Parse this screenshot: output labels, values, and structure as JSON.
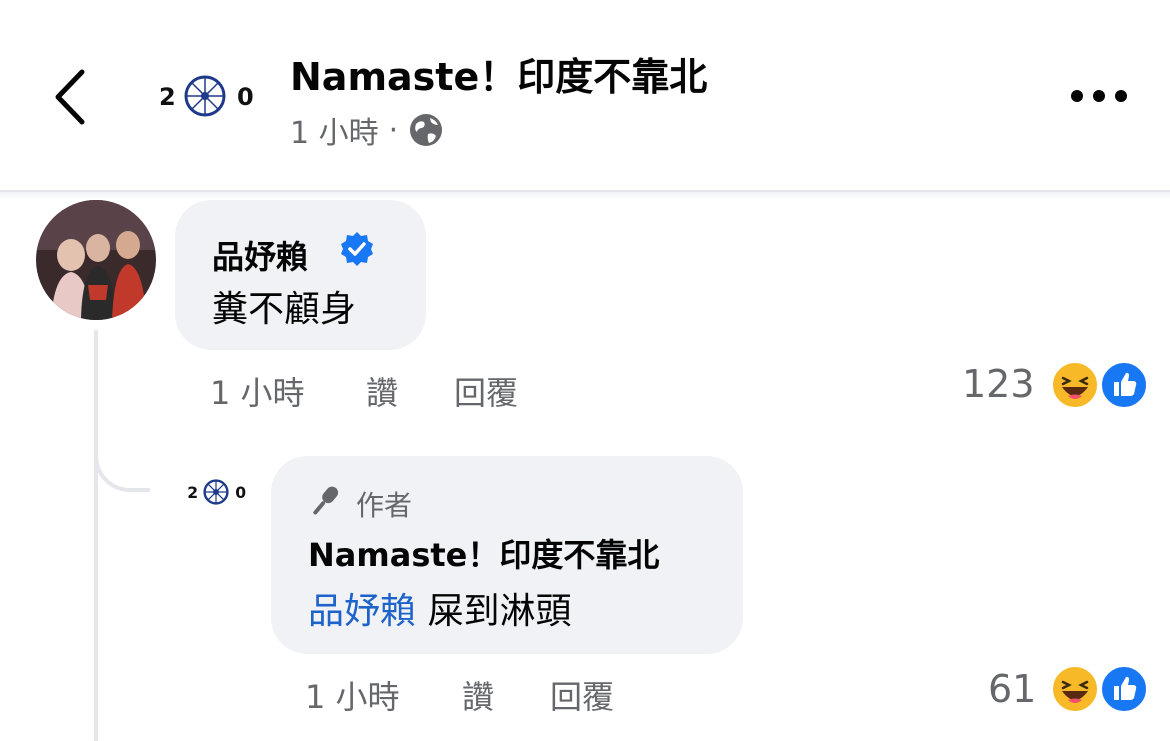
{
  "header": {
    "title": "Namaste！印度不靠北",
    "time": "1 小時",
    "separator": "·",
    "avatar_text_left": "2",
    "avatar_text_right": "0"
  },
  "comments": [
    {
      "author": "品妤賴",
      "verified": true,
      "text": "糞不顧身",
      "time": "1 小時",
      "like_label": "讚",
      "reply_label": "回覆",
      "reaction_count": "123",
      "reactions": [
        "haha-icon",
        "like-icon"
      ]
    },
    {
      "author_badge": "作者",
      "author": "Namaste！印度不靠北",
      "mention": "品妤賴",
      "text": "屎到淋頭",
      "time": "1 小時",
      "like_label": "讚",
      "reply_label": "回覆",
      "reaction_count": "61",
      "reactions": [
        "haha-icon",
        "like-icon"
      ]
    }
  ],
  "colors": {
    "saffron": "#f39a1c",
    "green": "#2f9a3a",
    "chakra": "#1f3a8a",
    "mention": "#1d63c9",
    "verified": "#1877f2",
    "meta": "#65676b",
    "bubble": "#f0f2f5"
  }
}
